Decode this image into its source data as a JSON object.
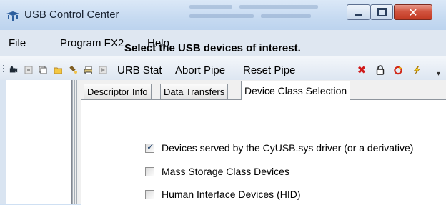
{
  "window": {
    "title": "USB Control Center",
    "controls": {
      "minimize": "minimize",
      "maximize": "maximize",
      "close": "close"
    }
  },
  "menu": [
    "File",
    "Program FX2",
    "Help"
  ],
  "toolbar": {
    "icons_left": [
      "camera-icon",
      "stop-icon",
      "copy-icon",
      "open-folder-icon",
      "search-icon",
      "print-icon",
      "play-icon"
    ],
    "buttons": [
      "URB Stat",
      "Abort Pipe",
      "Reset Pipe"
    ],
    "icons_right": [
      "red-x-icon",
      "lock-icon",
      "power-cycle-icon",
      "lightning-icon"
    ]
  },
  "tabs": [
    "Descriptor Info",
    "Data Transfers",
    "Device Class Selection"
  ],
  "selected_tab": "Device Class Selection",
  "content": {
    "heading": "Select the USB devices of interest.",
    "options": [
      {
        "label": "Devices served by the CyUSB.sys driver (or a derivative)",
        "checked": true
      },
      {
        "label": "Mass Storage Class Devices",
        "checked": false
      },
      {
        "label": "Human Interface Devices (HID)",
        "checked": false
      }
    ]
  },
  "colors": {
    "title_bar": "#c6daf1",
    "close_button": "#c23a23",
    "check_mark": "#21446e"
  }
}
